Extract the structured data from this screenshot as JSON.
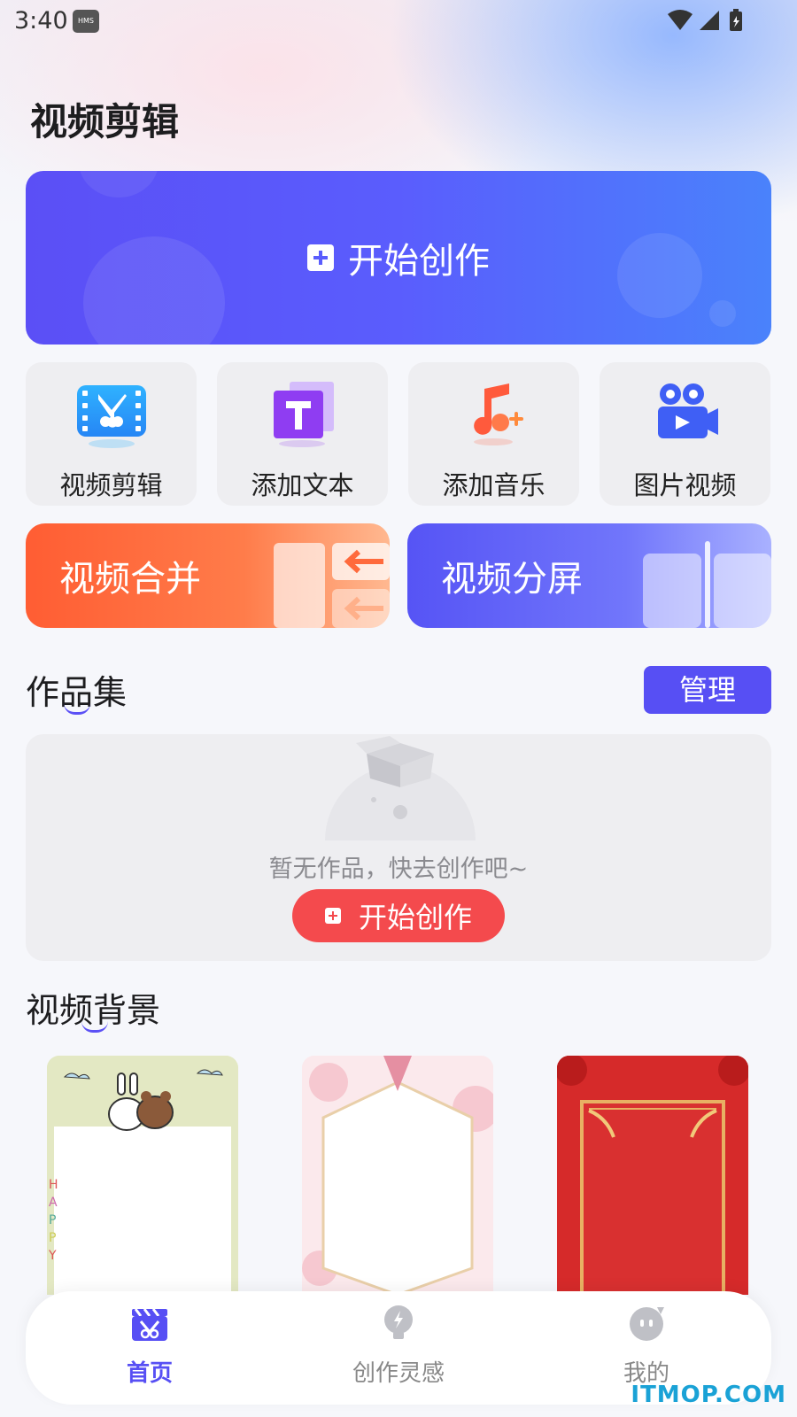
{
  "status_bar": {
    "time": "3:40",
    "hms_badge": "HMS"
  },
  "page_title": "视频剪辑",
  "hero": {
    "label": "开始创作"
  },
  "tools": [
    {
      "label": "视频剪辑",
      "icon": "film-scissors-icon"
    },
    {
      "label": "添加文本",
      "icon": "text-T-icon"
    },
    {
      "label": "添加音乐",
      "icon": "music-plus-icon"
    },
    {
      "label": "图片视频",
      "icon": "video-camera-icon"
    }
  ],
  "feature_cards": {
    "merge": {
      "label": "视频合并"
    },
    "split": {
      "label": "视频分屏"
    }
  },
  "works": {
    "title": "作品集",
    "manage_label": "管理",
    "empty_text": "暂无作品，快去创作吧~",
    "start_label": "开始创作"
  },
  "backgrounds": {
    "title": "视频背景",
    "items": [
      "cute-bear-bunny-frame",
      "pink-floral-frame",
      "red-chinese-frame"
    ]
  },
  "tabbar": {
    "items": [
      {
        "label": "首页",
        "active": true
      },
      {
        "label": "创作灵感",
        "active": false
      },
      {
        "label": "我的",
        "active": false
      }
    ]
  },
  "watermark": "ITMOP.COM",
  "colors": {
    "primary": "#574ff4",
    "accent_red": "#f44a4d",
    "orange": "#ff5d33"
  }
}
